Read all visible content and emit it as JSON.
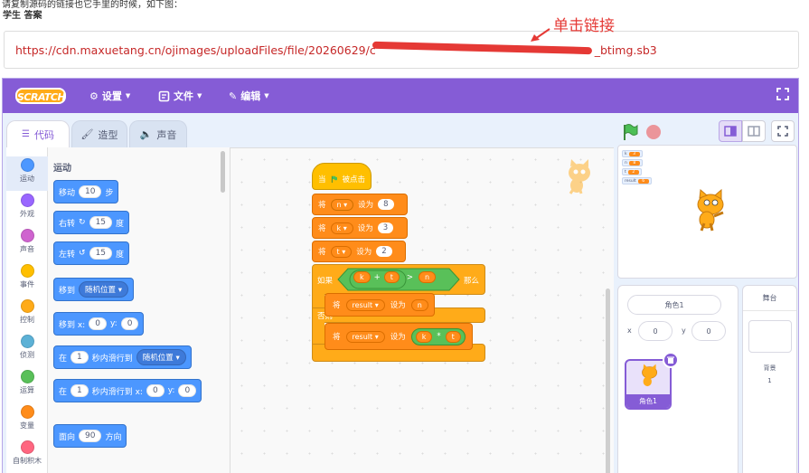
{
  "page": {
    "top_cut_text": "请复制源码的链接也它手里的时候，如下图：",
    "answer_label": "学生 答案",
    "link_visible_start": "https://cdn.maxuetang.cn/ojimages/uploadFiles/file/20260629/c",
    "link_visible_end": "_btimg.sb3",
    "annotation": "单击链接",
    "accent_red": "#e53935"
  },
  "menubar": {
    "logo": "SCRATCH",
    "settings": "设置",
    "file": "文件",
    "edit": "编辑",
    "color": "#855cd6"
  },
  "tabs": {
    "code": "代码",
    "costumes": "造型",
    "sounds": "声音"
  },
  "categories": [
    {
      "label": "运动",
      "color": "#4c97ff"
    },
    {
      "label": "外观",
      "color": "#9966ff"
    },
    {
      "label": "声音",
      "color": "#cf63cf"
    },
    {
      "label": "事件",
      "color": "#ffbf00"
    },
    {
      "label": "控制",
      "color": "#ffab19"
    },
    {
      "label": "侦测",
      "color": "#5cb1d6"
    },
    {
      "label": "运算",
      "color": "#59c059"
    },
    {
      "label": "变量",
      "color": "#ff8c1a"
    },
    {
      "label": "自制积木",
      "color": "#ff6680"
    }
  ],
  "palette": {
    "title": "运动",
    "move": {
      "a": "移动",
      "n": "10",
      "b": "步"
    },
    "turn_right": {
      "a": "右转",
      "n": "15",
      "b": "度"
    },
    "turn_left": {
      "a": "左转",
      "n": "15",
      "b": "度"
    },
    "goto": {
      "a": "移到",
      "d": "随机位置"
    },
    "goto_xy": {
      "a": "移到 x:",
      "x": "0",
      "b": "y:",
      "y": "0"
    },
    "glide": {
      "a": "在",
      "n": "1",
      "b": "秒内滑行到",
      "d": "随机位置"
    },
    "glide_xy": {
      "a": "在",
      "n": "1",
      "b": "秒内滑行到 x:",
      "x": "0",
      "c": "y:",
      "y": "0"
    },
    "point": {
      "a": "面向",
      "n": "90",
      "b": "方向"
    }
  },
  "script": {
    "hat_a": "当",
    "hat_b": "被点击",
    "set_word": "将",
    "to_word": "设为",
    "sets": [
      {
        "var": "n",
        "val": "8"
      },
      {
        "var": "k",
        "val": "3"
      },
      {
        "var": "t",
        "val": "2"
      }
    ],
    "if_label": "如果",
    "then_label": "那么",
    "else_label": "否则",
    "cond": {
      "a": "k",
      "op1": "+",
      "b": "t",
      "cmp": ">",
      "c": "n"
    },
    "if_set": {
      "var": "result",
      "val": "n"
    },
    "else_set": {
      "var": "result",
      "a": "k",
      "op": "*",
      "b": "t"
    }
  },
  "stage": {
    "monitors": [
      {
        "name": "k",
        "value": "3"
      },
      {
        "name": "n",
        "value": "8"
      },
      {
        "name": "t",
        "value": "2"
      },
      {
        "name": "result",
        "value": "6"
      }
    ]
  },
  "sprite_info": {
    "name": "角色1",
    "x_label": "x",
    "x": "0",
    "y_label": "y",
    "y": "0",
    "thumb_name": "角色1"
  },
  "stage_pane": {
    "header": "舞台",
    "backdrops_label": "背景",
    "backdrops_count": "1"
  }
}
